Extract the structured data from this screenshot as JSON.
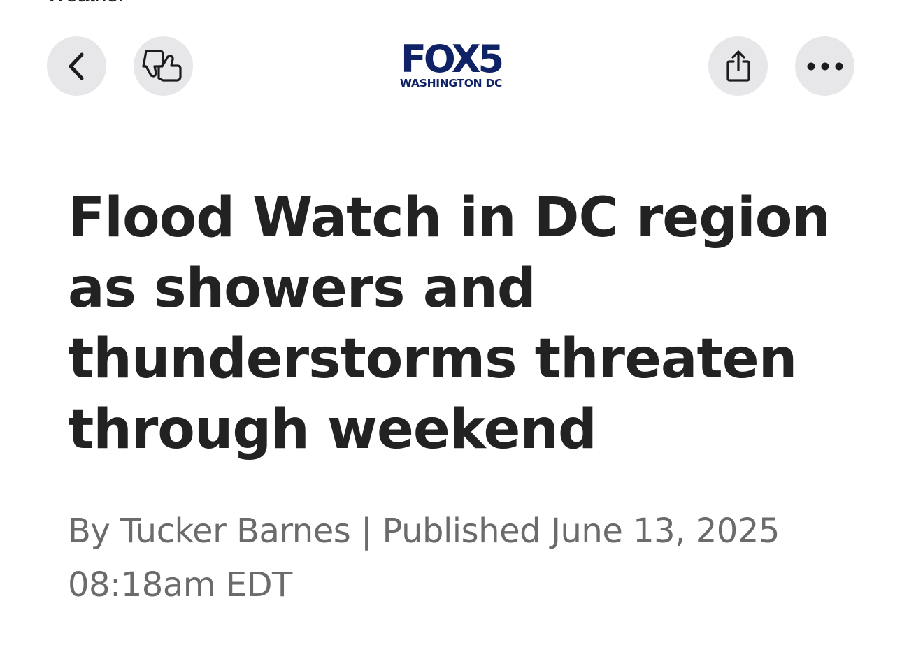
{
  "top_partial_text": "‹ Weather",
  "toolbar": {
    "back_icon": "chevron-left-icon",
    "reaction_icon": "thumbs-down-up-icon",
    "share_icon": "share-icon",
    "more_icon": "ellipsis-icon"
  },
  "logo": {
    "primary": "FOX5",
    "secondary": "WASHINGTON DC",
    "color": "#0e2265"
  },
  "article": {
    "headline_lines": [
      "Flood Watch in DC region",
      "as showers and",
      "thunderstorms threaten",
      "through weekend"
    ],
    "byline": {
      "author_prefix": "By",
      "author": "Tucker Barnes",
      "separator": "|",
      "published_label": "Published",
      "date": "June 13, 2025",
      "time": "08:18am EDT"
    }
  }
}
